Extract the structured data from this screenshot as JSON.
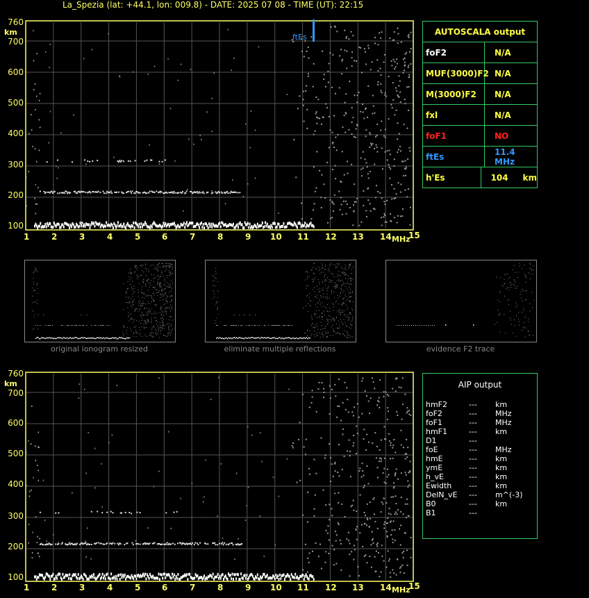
{
  "title": "La_Spezia (lat: +44.1, lon: 009.8) - DATE: 2025 07 08 - TIME (UT): 22:15",
  "axis": {
    "y_ticks": [
      "760",
      "700",
      "600",
      "500",
      "400",
      "300",
      "200",
      "100"
    ],
    "y_unit": "km",
    "x_ticks": [
      "1",
      "2",
      "3",
      "4",
      "5",
      "6",
      "7",
      "8",
      "9",
      "10",
      "11",
      "12",
      "13",
      "14",
      "15"
    ],
    "x_unit": "MHz"
  },
  "ftes_marker_label": "ftEs",
  "autoscala": {
    "title": "AUTOSCALA output",
    "rows": [
      {
        "name": "foF2",
        "value": "N/A",
        "name_color": "#ffffff",
        "value_color": "#ffff44"
      },
      {
        "name": "MUF(3000)F2",
        "value": "N/A",
        "name_color": "#ffff44",
        "value_color": "#ffff44"
      },
      {
        "name": "M(3000)F2",
        "value": "N/A",
        "name_color": "#ffff44",
        "value_color": "#ffff44"
      },
      {
        "name": "fxl",
        "value": "N/A",
        "name_color": "#ffff44",
        "value_color": "#ffff44"
      },
      {
        "name": "foF1",
        "value": "NO",
        "name_color": "#ff2020",
        "value_color": "#ff2020"
      },
      {
        "name": "ftEs",
        "value": "11.4 MHz",
        "name_color": "#3399ff",
        "value_color": "#3399ff"
      },
      {
        "name": "h'Es",
        "value": "104     km",
        "name_color": "#ffff44",
        "value_color": "#ffff44"
      }
    ]
  },
  "thumbnails": [
    {
      "caption": "original ionogram resized"
    },
    {
      "caption": "eliminate multiple reflections"
    },
    {
      "caption": "evidence F2 trace"
    }
  ],
  "aip": {
    "title": "AIP output",
    "rows": [
      {
        "name": "hmF2",
        "value": "---",
        "unit": "km"
      },
      {
        "name": "foF2",
        "value": "---",
        "unit": "MHz"
      },
      {
        "name": "foF1",
        "value": "---",
        "unit": "MHz"
      },
      {
        "name": "hmF1",
        "value": "---",
        "unit": "km"
      },
      {
        "name": "D1",
        "value": "---",
        "unit": ""
      },
      {
        "name": "foE",
        "value": "---",
        "unit": "MHz"
      },
      {
        "name": "hmE",
        "value": "---",
        "unit": "km"
      },
      {
        "name": "ymE",
        "value": "---",
        "unit": "km"
      },
      {
        "name": "h_vE",
        "value": "---",
        "unit": "km"
      },
      {
        "name": "Ewidth",
        "value": "---",
        "unit": "km"
      },
      {
        "name": "DelN_vE",
        "value": "---",
        "unit": "m^(-3)"
      },
      {
        "name": "B0",
        "value": "---",
        "unit": "km"
      },
      {
        "name": "B1",
        "value": "---",
        "unit": ""
      }
    ]
  },
  "chart_data": [
    {
      "type": "scatter",
      "xlabel": "MHz",
      "ylabel": "km",
      "xlim": [
        1,
        15
      ],
      "ylim": [
        100,
        760
      ],
      "grid": true,
      "ftEs_MHz": 11.4,
      "traces": [
        {
          "x_range": [
            1.3,
            11.4
          ],
          "h_km": 115
        },
        {
          "x_range": [
            1.5,
            8.8
          ],
          "h_km": 218
        },
        {
          "x_range": [
            1.5,
            6.5
          ],
          "h_km": 318
        }
      ]
    }
  ]
}
